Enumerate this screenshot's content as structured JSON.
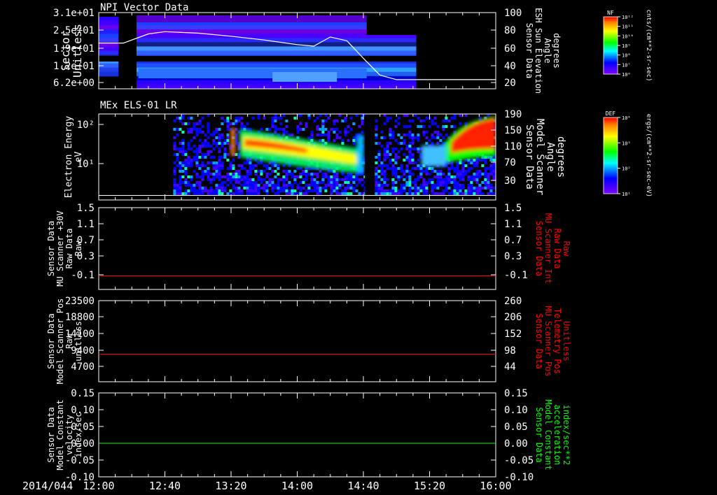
{
  "colors": {
    "axis": "#ffffff",
    "background": "#000000",
    "red": "#ff0000",
    "green": "#00ff00",
    "trace": "#ffffff"
  },
  "chart_data": [
    {
      "type": "heatmap",
      "title": "NPI Vector Data",
      "ylabel": [
        "Sector",
        "Unitless"
      ],
      "ylabel_right": [
        "Sensor Data",
        "ESH Sun Elevation",
        "Angle",
        "degrees"
      ],
      "yticks": [
        "3.1e+01",
        "2.5e+01",
        "1.9e+01",
        "1.2e+01",
        "6.2e+00"
      ],
      "yticks_right": [
        "100",
        "80",
        "60",
        "40",
        "20"
      ],
      "ylim": [
        0,
        31
      ],
      "ylim_right": [
        0,
        100
      ],
      "colorbar": {
        "label": "NF",
        "units": "cnts/(cm**2-sr-sec)",
        "ticks": [
          "10¹²",
          "10¹¹",
          "10¹⁰",
          "10⁹",
          "10⁸",
          "10⁷",
          "10⁶"
        ]
      },
      "data_gaps_hours": [
        [
          12.45,
          12.6
        ],
        [
          15.2,
          16.0
        ]
      ],
      "series": [
        {
          "x": [
            "12:00",
            "12:15",
            "12:30",
            "12:40",
            "13:00",
            "13:20",
            "13:40",
            "14:00",
            "14:10",
            "14:20",
            "14:30",
            "14:40",
            "14:50",
            "15:00",
            "15:10",
            "15:20",
            "16:00"
          ],
          "values": [
            60,
            60,
            72,
            75,
            73,
            69,
            64,
            58,
            56,
            68,
            63,
            40,
            18,
            12,
            12,
            12,
            12
          ]
        }
      ]
    },
    {
      "type": "heatmap",
      "title": "MEx ELS-01 LR",
      "ylabel": [
        "Electron Energy",
        "eV"
      ],
      "ylabel_right": [
        "Sensor Data",
        "Model Scanner",
        "Angle",
        "degrees"
      ],
      "yticks": [
        "10²",
        "10¹"
      ],
      "yticks_right": [
        "190",
        "150",
        "110",
        "70",
        "30"
      ],
      "ylim_right": [
        0,
        190
      ],
      "colorbar": {
        "label": "DEF",
        "units": "ergs/(cm**2-sr-sec-eV)",
        "ticks": [
          "10⁴",
          "10³",
          "10²",
          "10¹"
        ]
      },
      "data_start": "12:45",
      "series": [
        {
          "x": [
            "12:00",
            "16:00"
          ],
          "values": [
            10,
            10
          ]
        }
      ]
    },
    {
      "type": "line",
      "ylabel": [
        "Sensor Data",
        "MU Scanner +30V",
        "Raw Data",
        "Raw"
      ],
      "ylabel_right": [
        "Sensor Data",
        "MU Scanner Int",
        "Raw Data",
        "Raw"
      ],
      "yticks": [
        "1.5",
        "1.1",
        "0.7",
        "0.3",
        "-0.1"
      ],
      "yticks_right": [
        "1.5",
        "1.1",
        "0.7",
        "0.3",
        "-0.1"
      ],
      "ylim": [
        -0.3,
        1.5
      ],
      "series": [
        {
          "x": [
            "12:00",
            "16:00"
          ],
          "values": [
            0,
            0
          ],
          "color": "#ff0000"
        }
      ]
    },
    {
      "type": "line",
      "ylabel": [
        "Sensor Data",
        "Model Scanner Pos",
        "Raw",
        "unitless"
      ],
      "ylabel_right": [
        "Sensor Data",
        "MU Scanner Pos",
        "Telemetry Pos",
        "Unitless"
      ],
      "yticks": [
        "23500",
        "18800",
        "14100",
        "9400",
        "4700"
      ],
      "yticks_right": [
        "260",
        "206",
        "152",
        "98",
        "44"
      ],
      "ylim": [
        0,
        23500
      ],
      "ylim_right": [
        0,
        260
      ],
      "series": [
        {
          "x": [
            "12:00",
            "16:00"
          ],
          "values": [
            8000,
            8000
          ],
          "color": "#ff0000"
        }
      ]
    },
    {
      "type": "line",
      "ylabel": [
        "Sensor Data",
        "Model Constant",
        "velocity",
        "index/sec"
      ],
      "ylabel_right": [
        "Sensor Data",
        "Model Constant",
        "acceleration",
        "index/sec**2"
      ],
      "yticks": [
        "0.15",
        "0.10",
        "0.05",
        "0.00",
        "-0.05",
        "-0.10"
      ],
      "yticks_right": [
        "0.15",
        "0.10",
        "0.05",
        "0.00",
        "-0.05",
        "-0.10"
      ],
      "ylim": [
        -0.1,
        0.15
      ],
      "series": [
        {
          "x": [
            "12:00",
            "16:00"
          ],
          "values": [
            0,
            0
          ],
          "color": "#00ff00"
        }
      ]
    }
  ],
  "xaxis": {
    "date": "2014/044",
    "ticks": [
      "12:00",
      "12:40",
      "13:20",
      "14:00",
      "14:40",
      "15:20",
      "16:00"
    ],
    "xlim": [
      "12:00",
      "16:00"
    ]
  }
}
